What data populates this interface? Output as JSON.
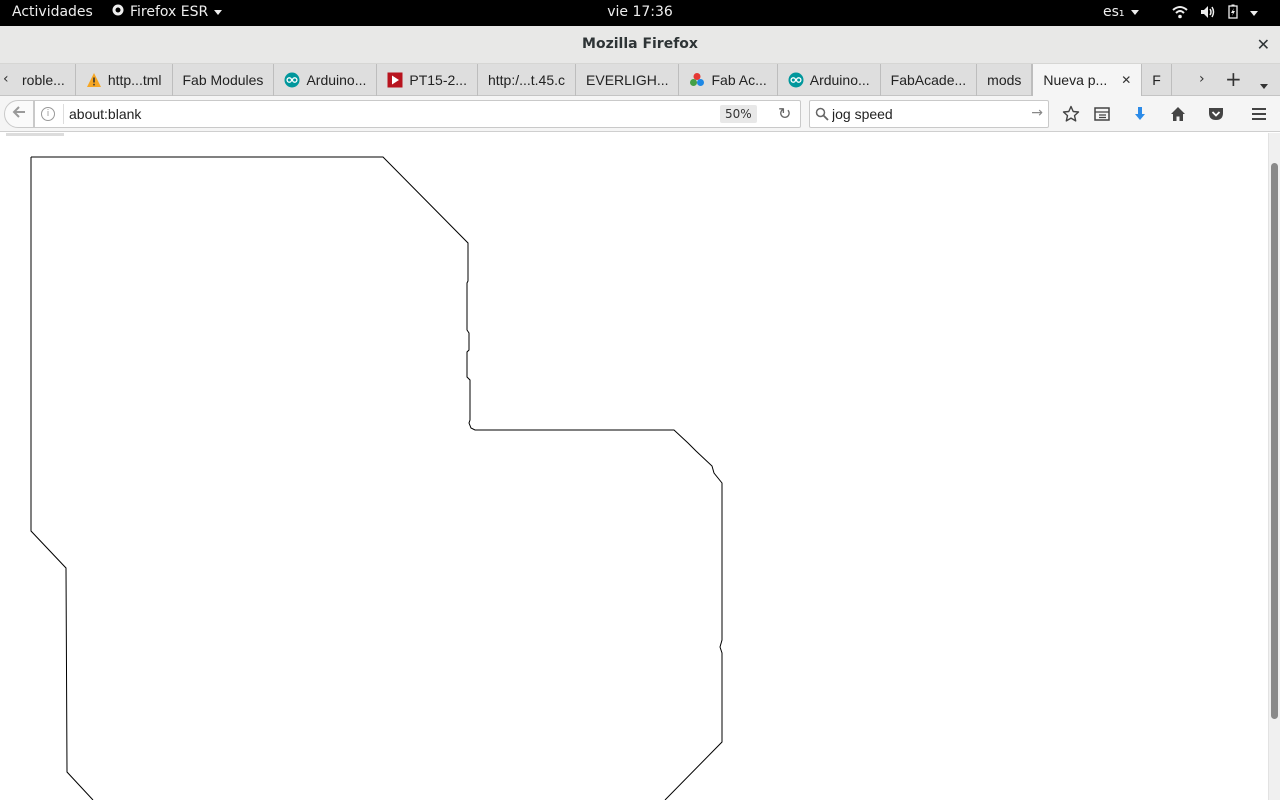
{
  "topbar": {
    "activities": "Actividades",
    "app_menu": "Firefox ESR",
    "clock": "vie 17:36",
    "language": "es₁",
    "icons": [
      "wifi-icon",
      "volume-icon",
      "battery-icon",
      "system-menu-icon"
    ]
  },
  "window": {
    "title": "Mozilla Firefox",
    "close_label": "✕"
  },
  "tabs": [
    {
      "label": "roble...",
      "icon": "none"
    },
    {
      "label": "http...tml",
      "icon": "warning-icon"
    },
    {
      "label": "Fab Modules",
      "icon": "none"
    },
    {
      "label": "Arduino...",
      "icon": "arduino-icon"
    },
    {
      "label": "PT15-2...",
      "icon": "red-play-icon"
    },
    {
      "label": "http:/...t.45.c",
      "icon": "none"
    },
    {
      "label": "EVERLIGH...",
      "icon": "none"
    },
    {
      "label": "Fab Ac...",
      "icon": "fablab-icon"
    },
    {
      "label": "Arduino...",
      "icon": "arduino-icon"
    },
    {
      "label": "FabAcade...",
      "icon": "none"
    },
    {
      "label": "mods",
      "icon": "none"
    },
    {
      "label": "Nueva p...",
      "icon": "none",
      "active": true
    },
    {
      "label": "F",
      "icon": "none"
    }
  ],
  "navbar": {
    "url": "about:blank",
    "zoom": "50%",
    "search_value": "jog speed",
    "accent": "#2c8be8"
  },
  "content": {
    "path_color": "#000000",
    "background": "#ffffff"
  }
}
